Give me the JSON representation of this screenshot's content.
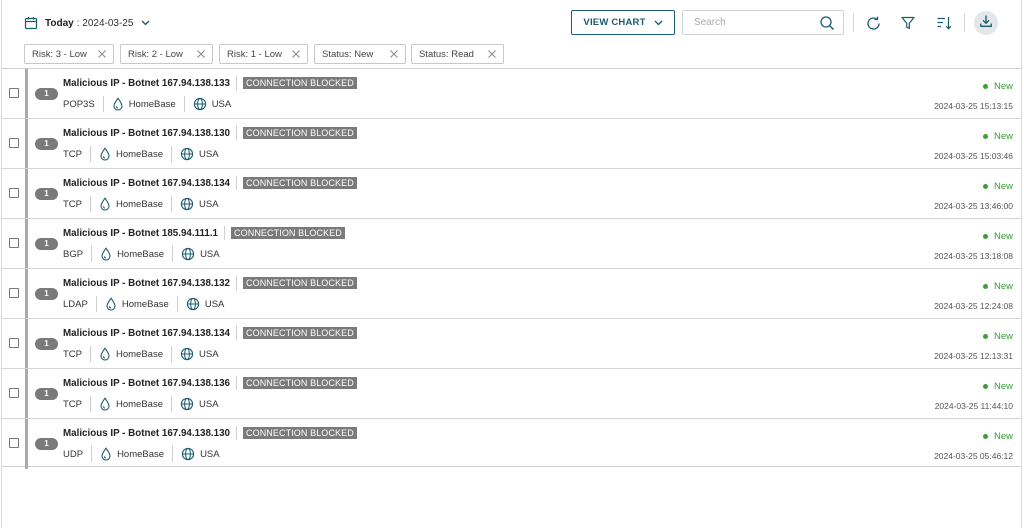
{
  "toolbar": {
    "date_label": "Today",
    "date_value": ": 2024-03-25",
    "view_chart_label": "VIEW CHART",
    "search_placeholder": "Search"
  },
  "filters": [
    {
      "label": "Risk: 3 - Low"
    },
    {
      "label": "Risk: 2 - Low"
    },
    {
      "label": "Risk: 1 - Low"
    },
    {
      "label": "Status: New"
    },
    {
      "label": "Status: Read"
    }
  ],
  "rows": [
    {
      "badge": "1",
      "title": "Malicious IP - Botnet 167.94.138.133",
      "tag": "CONNECTION BLOCKED",
      "protocol": "POP3S",
      "location": "HomeBase",
      "country": "USA",
      "status": "New",
      "timestamp": "2024-03-25 15:13:15"
    },
    {
      "badge": "1",
      "title": "Malicious IP - Botnet 167.94.138.130",
      "tag": "CONNECTION BLOCKED",
      "protocol": "TCP",
      "location": "HomeBase",
      "country": "USA",
      "status": "New",
      "timestamp": "2024-03-25 15:03:46"
    },
    {
      "badge": "1",
      "title": "Malicious IP - Botnet 167.94.138.134",
      "tag": "CONNECTION BLOCKED",
      "protocol": "TCP",
      "location": "HomeBase",
      "country": "USA",
      "status": "New",
      "timestamp": "2024-03-25 13:46:00"
    },
    {
      "badge": "1",
      "title": "Malicious IP - Botnet 185.94.111.1",
      "tag": "CONNECTION BLOCKED",
      "protocol": "BGP",
      "location": "HomeBase",
      "country": "USA",
      "status": "New",
      "timestamp": "2024-03-25 13:18:08"
    },
    {
      "badge": "1",
      "title": "Malicious IP - Botnet 167.94.138.132",
      "tag": "CONNECTION BLOCKED",
      "protocol": "LDAP",
      "location": "HomeBase",
      "country": "USA",
      "status": "New",
      "timestamp": "2024-03-25 12:24:08"
    },
    {
      "badge": "1",
      "title": "Malicious IP - Botnet 167.94.138.134",
      "tag": "CONNECTION BLOCKED",
      "protocol": "TCP",
      "location": "HomeBase",
      "country": "USA",
      "status": "New",
      "timestamp": "2024-03-25 12:13:31"
    },
    {
      "badge": "1",
      "title": "Malicious IP - Botnet 167.94.138.136",
      "tag": "CONNECTION BLOCKED",
      "protocol": "TCP",
      "location": "HomeBase",
      "country": "USA",
      "status": "New",
      "timestamp": "2024-03-25 11:44:10"
    },
    {
      "badge": "1",
      "title": "Malicious IP - Botnet 167.94.138.130",
      "tag": "CONNECTION BLOCKED",
      "protocol": "UDP",
      "location": "HomeBase",
      "country": "USA",
      "status": "New",
      "timestamp": "2024-03-25 05:46:12"
    }
  ],
  "icons": {
    "date": "calendar-icon",
    "refresh": "refresh-icon",
    "filter": "funnel-icon",
    "sort": "sort-icon",
    "download": "download-icon",
    "location": "drop-icon",
    "country": "globe-icon"
  },
  "colors": {
    "accent": "#1a5b6e",
    "status_new": "#3a9a3a",
    "tag_bg": "#7a7a7a"
  }
}
